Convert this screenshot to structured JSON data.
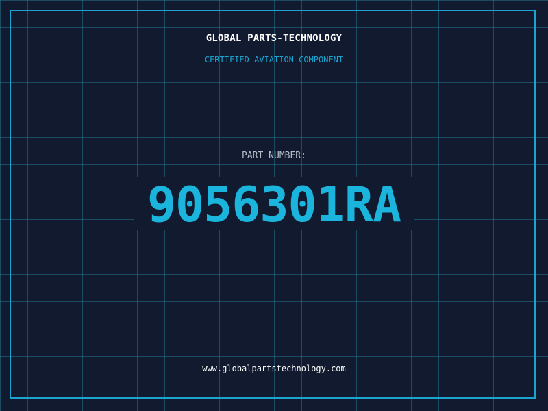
{
  "header": {
    "company": "GLOBAL PARTS-TECHNOLOGY",
    "tagline": "CERTIFIED AVIATION COMPONENT"
  },
  "part": {
    "label": "PART NUMBER:",
    "number": "9056301RA"
  },
  "footer": {
    "url": "www.globalpartstechnology.com"
  },
  "colors": {
    "background": "#111a2e",
    "grid": "#24748c",
    "accent": "#1aa4cf",
    "part_number": "#1ab4dc",
    "text_primary": "#ffffff",
    "text_muted": "#b5bcc8"
  }
}
